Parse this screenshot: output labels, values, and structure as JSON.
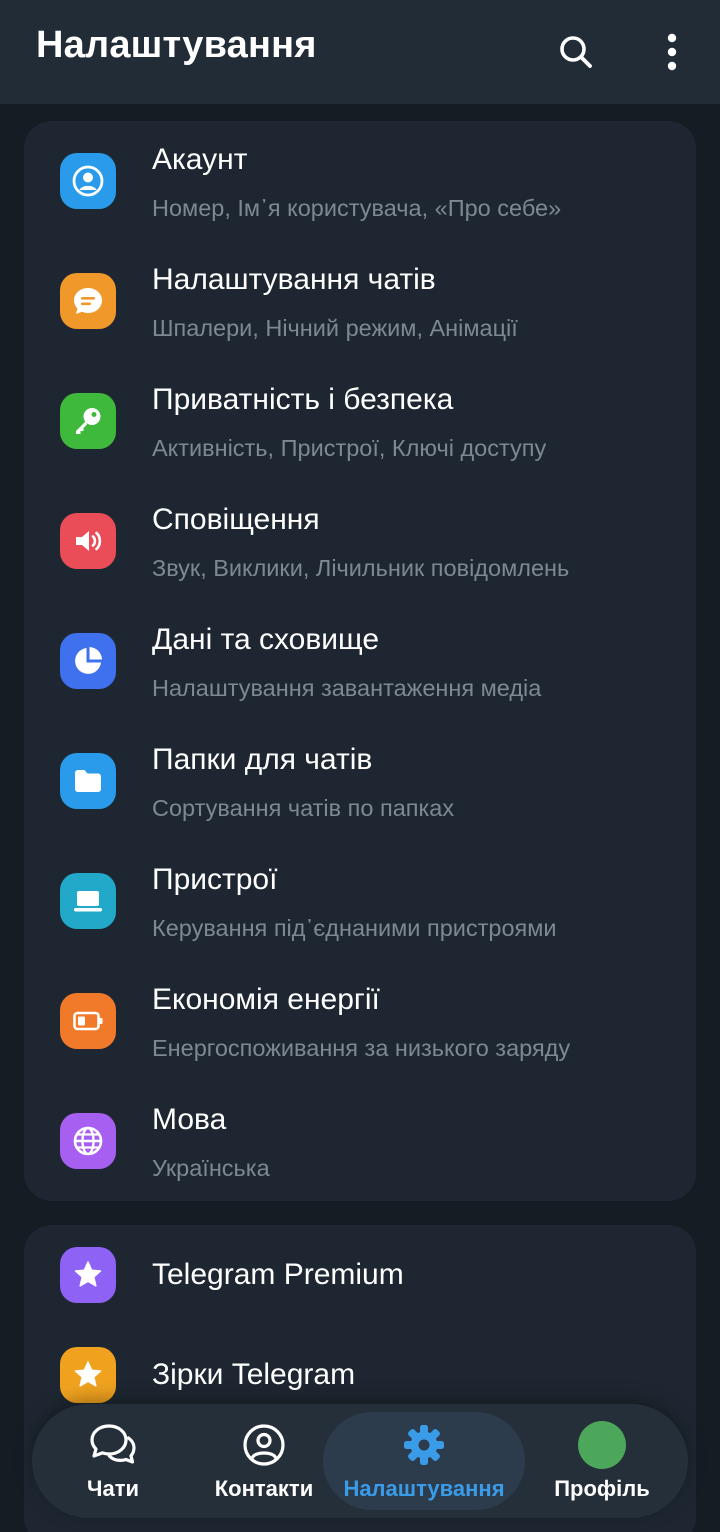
{
  "header": {
    "title": "Налаштування",
    "search_icon": "search-icon",
    "more_icon": "more-vertical-icon"
  },
  "colors": {
    "background": "#151c24",
    "header": "#222c37",
    "card": "#1e2731",
    "accent": "#3a9ce9",
    "subtext": "#7d8893"
  },
  "settings": {
    "items": [
      {
        "title": "Акаунт",
        "subtitle": "Номер, Ім᾽я користувача, «Про себе»",
        "icon": "person-icon",
        "color": "#2a9bea"
      },
      {
        "title": "Налаштування чатів",
        "subtitle": "Шпалери, Нічний режим, Анімації",
        "icon": "chat-bubble-icon",
        "color": "#f0982a"
      },
      {
        "title": "Приватність і безпека",
        "subtitle": "Активність, Пристрої, Ключі доступу",
        "icon": "key-icon",
        "color": "#3fb93b"
      },
      {
        "title": "Сповіщення",
        "subtitle": "Звук, Виклики, Лічильник повідомлень",
        "icon": "speaker-icon",
        "color": "#ea4d58"
      },
      {
        "title": "Дані та сховище",
        "subtitle": "Налаштування завантаження медіа",
        "icon": "pie-chart-icon",
        "color": "#3f70ee"
      },
      {
        "title": "Папки для чатів",
        "subtitle": "Сортування чатів по папках",
        "icon": "folder-icon",
        "color": "#2a9bea"
      },
      {
        "title": "Пристрої",
        "subtitle": "Керування під᾽єднаними пристроями",
        "icon": "laptop-icon",
        "color": "#22a9c9"
      },
      {
        "title": "Економія енергії",
        "subtitle": "Енергоспоживання за низького заряду",
        "icon": "battery-icon",
        "color": "#f07a2a"
      },
      {
        "title": "Мова",
        "subtitle": "Українська",
        "icon": "globe-icon",
        "color": "#a65ff0"
      }
    ]
  },
  "extra": {
    "items": [
      {
        "title": "Telegram Premium",
        "icon": "star-icon",
        "color": "#8e62f5"
      },
      {
        "title": "Зірки Telegram",
        "icon": "star-icon",
        "color": "#f0a21f"
      }
    ]
  },
  "bottom_nav": {
    "items": [
      {
        "label": "Чати",
        "icon": "chats-icon",
        "active": false
      },
      {
        "label": "Контакти",
        "icon": "contacts-icon",
        "active": false
      },
      {
        "label": "Налаштування",
        "icon": "gear-icon",
        "active": true
      },
      {
        "label": "Профіль",
        "icon": "avatar",
        "active": false
      }
    ]
  }
}
